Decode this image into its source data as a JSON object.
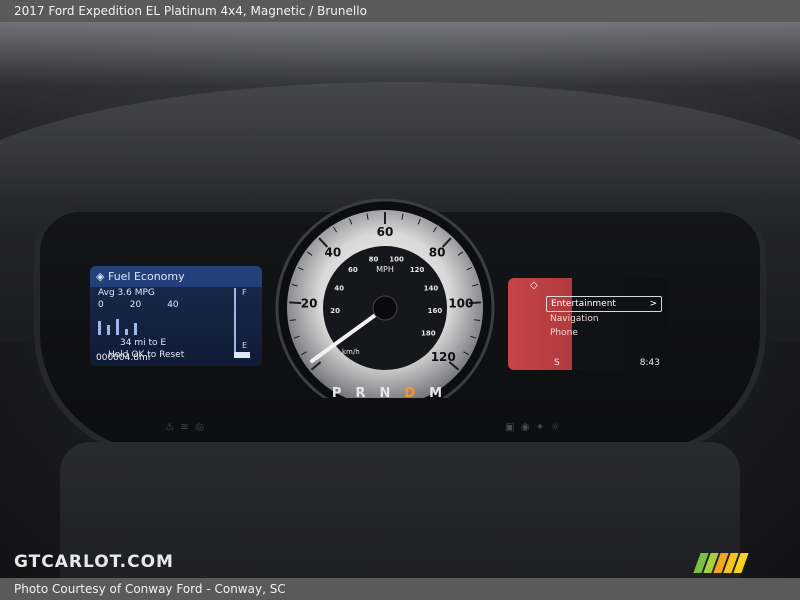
{
  "header": {
    "title": "2017 Ford Expedition EL Platinum 4x4,  Magnetic / Brunello"
  },
  "footer": {
    "credit": "Photo Courtesy of Conway Ford - Conway, SC"
  },
  "watermark": {
    "text": "GTCARLOT.COM"
  },
  "stripe_colors": [
    "#7ac143",
    "#a8cf3d",
    "#f5a623",
    "#f7c51e",
    "#f7d31e"
  ],
  "left_display": {
    "title": "Fuel Economy",
    "avg": "Avg 3.6 MPG",
    "scale": [
      "0",
      "20",
      "40"
    ],
    "range": "34 mi to E",
    "hint": "Hold OK to Reset",
    "odometer": "000004.8mi",
    "fuel_labels": [
      "F",
      "E"
    ]
  },
  "speedometer": {
    "unit": "MPH",
    "outer_labels": [
      "20",
      "40",
      "60",
      "80",
      "100",
      "120"
    ],
    "inner_labels": [
      "20",
      "40",
      "60",
      "80",
      "100",
      "120",
      "140",
      "160",
      "180"
    ],
    "kmh_label": "km/h"
  },
  "gear": {
    "options": [
      "P",
      "R",
      "N",
      "D",
      "M"
    ],
    "selected": "D"
  },
  "right_display": {
    "menu": [
      "Entertainment",
      "Navigation",
      "Phone"
    ],
    "selected": "Entertainment",
    "arrow": ">",
    "direction": "S",
    "time": "8:43"
  }
}
